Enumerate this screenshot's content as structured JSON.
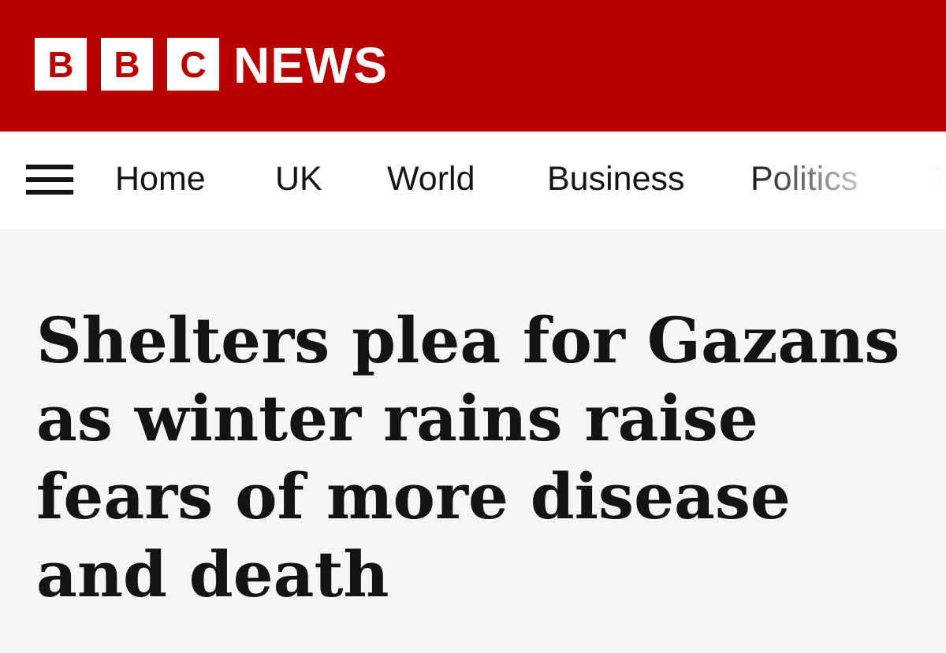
{
  "masthead": {
    "logo_blocks": [
      "B",
      "B",
      "C"
    ],
    "logo_text": "NEWS",
    "brand_color": "#b80000"
  },
  "nav": {
    "menu_icon": "hamburger-menu-icon",
    "items": [
      {
        "label": "Home"
      },
      {
        "label": "UK"
      },
      {
        "label": "World"
      },
      {
        "label": "Business"
      },
      {
        "label": "Politics"
      },
      {
        "label": "T"
      }
    ]
  },
  "article": {
    "headline": "Shelters plea for Gazans as winter rains raise fears of more disease and death"
  }
}
